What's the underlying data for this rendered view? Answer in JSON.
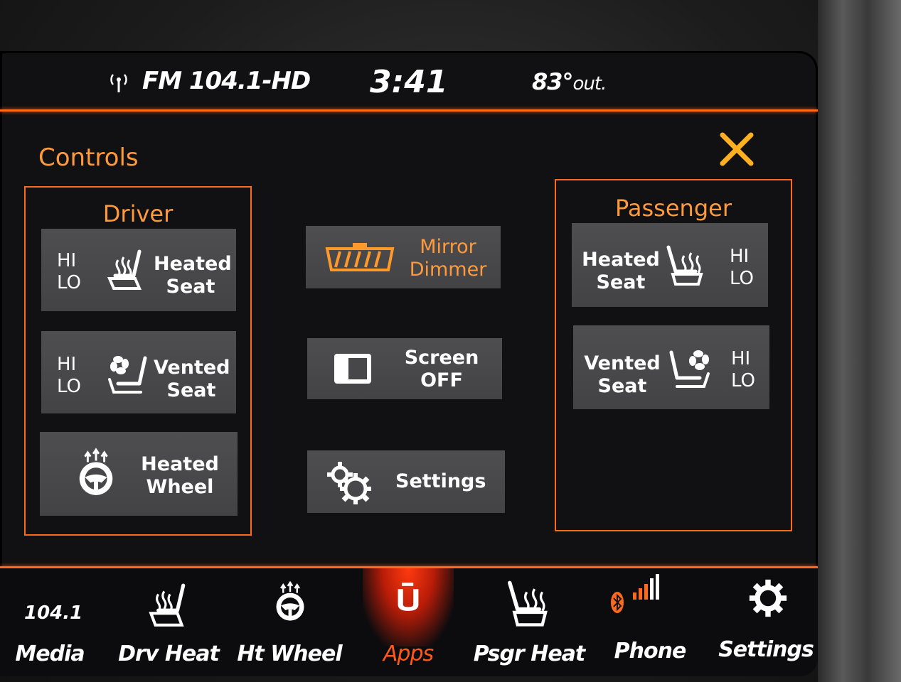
{
  "status": {
    "radio": "FM 104.1-HD",
    "clock": "3:41",
    "temp_value": "83°",
    "temp_unit": "out."
  },
  "page": {
    "title": "Controls"
  },
  "driver": {
    "title": "Driver",
    "heated_seat": {
      "hi": "HI",
      "lo": "LO",
      "label_line1": "Heated",
      "label_line2": "Seat"
    },
    "vented_seat": {
      "hi": "HI",
      "lo": "LO",
      "label_line1": "Vented",
      "label_line2": "Seat"
    },
    "heated_wheel": {
      "label_line1": "Heated",
      "label_line2": "Wheel"
    }
  },
  "center": {
    "mirror_dimmer": {
      "line1": "Mirror",
      "line2": "Dimmer"
    },
    "screen_off": {
      "line1": "Screen",
      "line2": "OFF"
    },
    "settings": {
      "label": "Settings"
    }
  },
  "passenger": {
    "title": "Passenger",
    "heated_seat": {
      "hi": "HI",
      "lo": "LO",
      "label_line1": "Heated",
      "label_line2": "Seat"
    },
    "vented_seat": {
      "hi": "HI",
      "lo": "LO",
      "label_line1": "Vented",
      "label_line2": "Seat"
    }
  },
  "nav": {
    "media_freq": "104.1",
    "items": [
      {
        "label": "Media",
        "icon": "radio-frequency"
      },
      {
        "label": "Drv Heat",
        "icon": "driver-seat-heat-icon"
      },
      {
        "label": "Ht Wheel",
        "icon": "heated-wheel-icon"
      },
      {
        "label": "Apps",
        "icon": "uconnect-apps-icon"
      },
      {
        "label": "Psgr Heat",
        "icon": "passenger-seat-heat-icon"
      },
      {
        "label": "Phone",
        "icon": "bluetooth-signal-icon"
      },
      {
        "label": "Settings",
        "icon": "gear-icon"
      }
    ]
  },
  "colors": {
    "accent": "#ff6a1a",
    "title_orange": "#ff9a3c",
    "active": "#ff5a1a",
    "close": "#ffb020"
  }
}
